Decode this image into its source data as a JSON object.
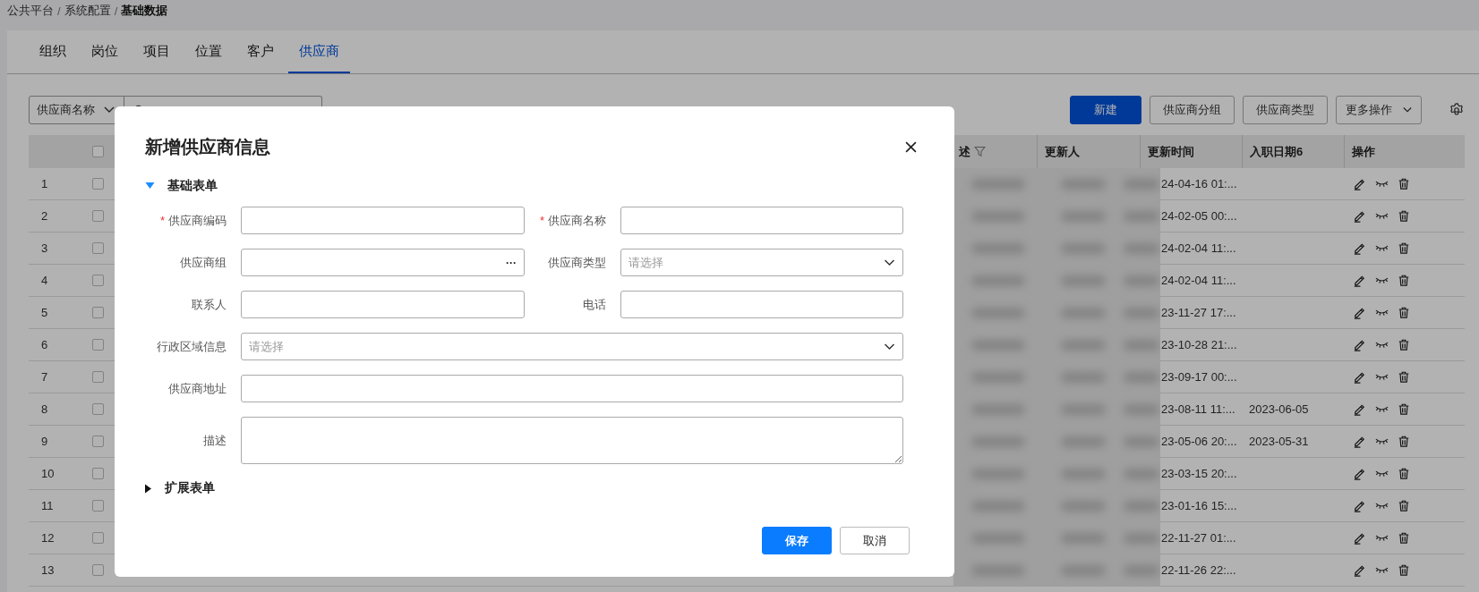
{
  "breadcrumb": {
    "separator": "/",
    "items": [
      {
        "label": "公共平台",
        "current": false
      },
      {
        "label": "系统配置",
        "current": false
      },
      {
        "label": "基础数据",
        "current": true
      }
    ]
  },
  "tabs": [
    {
      "label": "组织",
      "selected": false
    },
    {
      "label": "岗位",
      "selected": false
    },
    {
      "label": "项目",
      "selected": false
    },
    {
      "label": "位置",
      "selected": false
    },
    {
      "label": "客户",
      "selected": false
    },
    {
      "label": "供应商",
      "selected": true
    }
  ],
  "toolbar": {
    "filter_field": "供应商名称",
    "search": {
      "kind": "field"
    },
    "buttons": [
      {
        "label": "新建",
        "kind": "primary"
      },
      {
        "label": "供应商分组",
        "kind": "default"
      },
      {
        "label": "供应商类型",
        "kind": "default"
      },
      {
        "label": "更多操作",
        "kind": "dropdown"
      }
    ]
  },
  "table": {
    "header_checked": false,
    "columns": [
      {
        "label": "述",
        "filterable": true
      },
      {
        "label": "更新人",
        "filterable": false
      },
      {
        "label": "更新时间",
        "filterable": false
      },
      {
        "label": "入职日期6",
        "filterable": false
      },
      {
        "label": "操作",
        "filterable": false
      }
    ],
    "rows": [
      {
        "index": "1",
        "checked": false,
        "update_time": "24-04-16 01:..."
      },
      {
        "index": "2",
        "checked": false,
        "update_time": "24-02-05 00:..."
      },
      {
        "index": "3",
        "checked": false,
        "update_time": "24-02-04 11:..."
      },
      {
        "index": "4",
        "checked": false,
        "update_time": "24-02-04 11:..."
      },
      {
        "index": "5",
        "checked": false,
        "update_time": "23-11-27 17:..."
      },
      {
        "index": "6",
        "checked": false,
        "update_time": "23-10-28 21:..."
      },
      {
        "index": "7",
        "checked": false,
        "update_time": "23-09-17 00:..."
      },
      {
        "index": "8",
        "checked": false,
        "update_time": "23-08-11 11:...",
        "entry_date": "2023-06-05"
      },
      {
        "index": "9",
        "checked": false,
        "update_time": "23-05-06 20:...",
        "entry_date": "2023-05-31"
      },
      {
        "index": "10",
        "checked": false,
        "update_time": "23-03-15 20:..."
      },
      {
        "index": "11",
        "checked": false,
        "update_time": "23-01-16 15:..."
      },
      {
        "index": "12",
        "checked": false,
        "update_time": "22-11-27 01:..."
      },
      {
        "index": "13",
        "checked": false,
        "update_time": "22-11-26 22:..."
      }
    ]
  },
  "modal": {
    "title": "新增供应商信息",
    "sections": [
      {
        "title": "基础表单",
        "expanded": true,
        "fields": [
          {
            "label": "供应商编码",
            "required": true,
            "kind": "input",
            "full_width": false
          },
          {
            "label": "供应商名称",
            "required": true,
            "kind": "input",
            "full_width": false
          },
          {
            "label": "供应商组",
            "required": false,
            "kind": "picker",
            "full_width": false,
            "picker_text": "···"
          },
          {
            "label": "供应商类型",
            "required": false,
            "kind": "select",
            "placeholder": "请选择",
            "full_width": false
          },
          {
            "label": "联系人",
            "required": false,
            "kind": "input",
            "full_width": false
          },
          {
            "label": "电话",
            "required": false,
            "kind": "input",
            "full_width": false
          },
          {
            "label": "行政区域信息",
            "required": false,
            "kind": "select",
            "placeholder": "请选择",
            "full_width": true
          },
          {
            "label": "供应商地址",
            "required": false,
            "kind": "input",
            "full_width": true
          },
          {
            "label": "描述",
            "required": false,
            "kind": "textarea",
            "full_width": true
          }
        ]
      },
      {
        "title": "扩展表单",
        "expanded": false
      }
    ],
    "required_mark": "*",
    "buttons": [
      {
        "label": "保存",
        "kind": "primary"
      },
      {
        "label": "取消",
        "kind": "default"
      }
    ]
  }
}
